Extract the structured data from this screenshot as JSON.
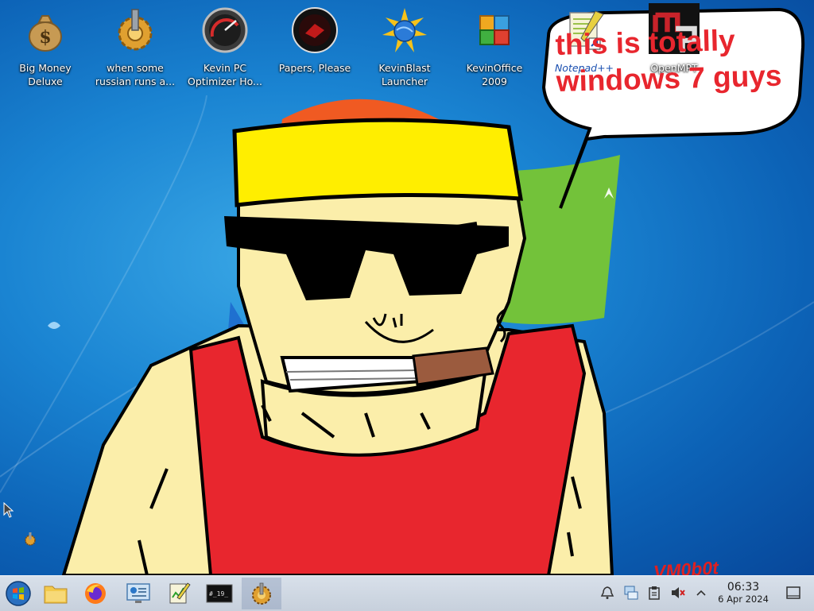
{
  "desktop": {
    "icons": [
      {
        "label": "Big Money\nDeluxe",
        "icon": "money-bag-icon"
      },
      {
        "label": "when some\nrussian runs a...",
        "icon": "gold-gear-icon"
      },
      {
        "label": "Kevin PC\nOptimizer Ho...",
        "icon": "speedometer-icon"
      },
      {
        "label": "Papers, Please",
        "icon": "red-seal-icon"
      },
      {
        "label": "KevinBlast\nLauncher",
        "icon": "globe-burst-icon"
      },
      {
        "label": "KevinOffice\n2009",
        "icon": "office-squares-icon"
      },
      {
        "label": "Notepad++",
        "icon": "notepad-plus-plus-icon"
      },
      {
        "label": "OpenMPT",
        "icon": "openmpt-icon"
      }
    ],
    "speech_bubble_text": "this is totally\nwindows 7 guys",
    "watermark": "VM0b0t"
  },
  "taskbar": {
    "items": [
      {
        "icon": "start-orb-icon",
        "active": false
      },
      {
        "icon": "file-manager-icon",
        "active": false
      },
      {
        "icon": "firefox-icon",
        "active": false
      },
      {
        "icon": "system-monitor-icon",
        "active": false
      },
      {
        "icon": "notepad-plus-plus-icon",
        "active": false
      },
      {
        "icon": "terminal-icon",
        "active": false
      },
      {
        "icon": "gold-gear-icon",
        "active": true
      }
    ],
    "terminal_glyph": "#_19_",
    "tray": [
      "notifications-bell-icon",
      "network-icon",
      "clipboard-icon",
      "volume-muted-icon",
      "chevron-up-icon"
    ],
    "clock": {
      "time": "06:33",
      "date": "6 Apr 2024"
    },
    "show_desktop": "show-desktop-icon"
  },
  "colors": {
    "speech_text": "#e8262e",
    "taskbar": "#d0d8e3",
    "desktop_blue": "#1a84d2"
  }
}
